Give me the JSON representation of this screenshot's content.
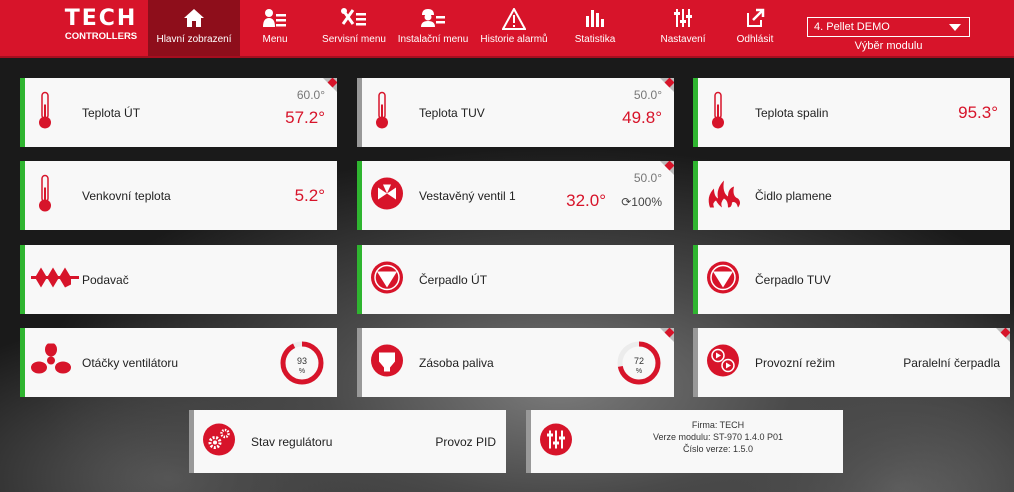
{
  "logo": {
    "line1": "TECH",
    "line2": "CONTROLLERS"
  },
  "nav": [
    {
      "label": "Hlavní zobrazení",
      "icon": "home-icon"
    },
    {
      "label": "Menu",
      "icon": "user-menu-icon"
    },
    {
      "label": "Servisní menu",
      "icon": "tools-menu-icon"
    },
    {
      "label": "Instalační menu",
      "icon": "installer-menu-icon"
    },
    {
      "label": "Historie alarmů",
      "icon": "warning-icon"
    },
    {
      "label": "Statistika",
      "icon": "statistics-icon"
    },
    {
      "label": "Nastavení",
      "icon": "sliders-icon"
    },
    {
      "label": "Odhlásit",
      "icon": "logout-icon"
    }
  ],
  "module": {
    "selected": "4. Pellet DEMO",
    "caption": "Výběr modulu"
  },
  "tiles": {
    "teplota_ut": {
      "label": "Teplota ÚT",
      "setpoint": "60.0°",
      "value": "57.2°"
    },
    "teplota_tuv": {
      "label": "Teplota TUV",
      "setpoint": "50.0°",
      "value": "49.8°"
    },
    "teplota_spalin": {
      "label": "Teplota spalin",
      "value": "95.3°"
    },
    "venkovni": {
      "label": "Venkovní teplota",
      "value": "5.2°"
    },
    "ventil": {
      "label": "Vestavěný ventil 1",
      "setpoint": "50.0°",
      "value": "32.0°",
      "opening": "100%"
    },
    "plamen": {
      "label": "Čidlo plamene"
    },
    "podavac": {
      "label": "Podavač"
    },
    "cerpadlo_ut": {
      "label": "Čerpadlo ÚT"
    },
    "cerpadlo_tuv": {
      "label": "Čerpadlo TUV"
    },
    "ventilator": {
      "label": "Otáčky ventilátoru",
      "percent": 93,
      "percent_text": "93",
      "unit": "%"
    },
    "palivo": {
      "label": "Zásoba paliva",
      "percent": 72,
      "percent_text": "72",
      "unit": "%"
    },
    "rezim": {
      "label": "Provozní režim",
      "value": "Paralelní čerpadla"
    },
    "regulator": {
      "label": "Stav regulátoru",
      "value": "Provoz PID"
    },
    "info": {
      "firma": "Firma: TECH",
      "verze_modulu": "Verze modulu: ST-970 1.4.0 P01",
      "cislo_verze": "Číslo verze: 1.5.0"
    }
  },
  "colors": {
    "brand": "#d7142a",
    "active_nav": "#8e0e1b",
    "status_green": "#2fb530",
    "tile_bg": "#f8f8f8"
  }
}
